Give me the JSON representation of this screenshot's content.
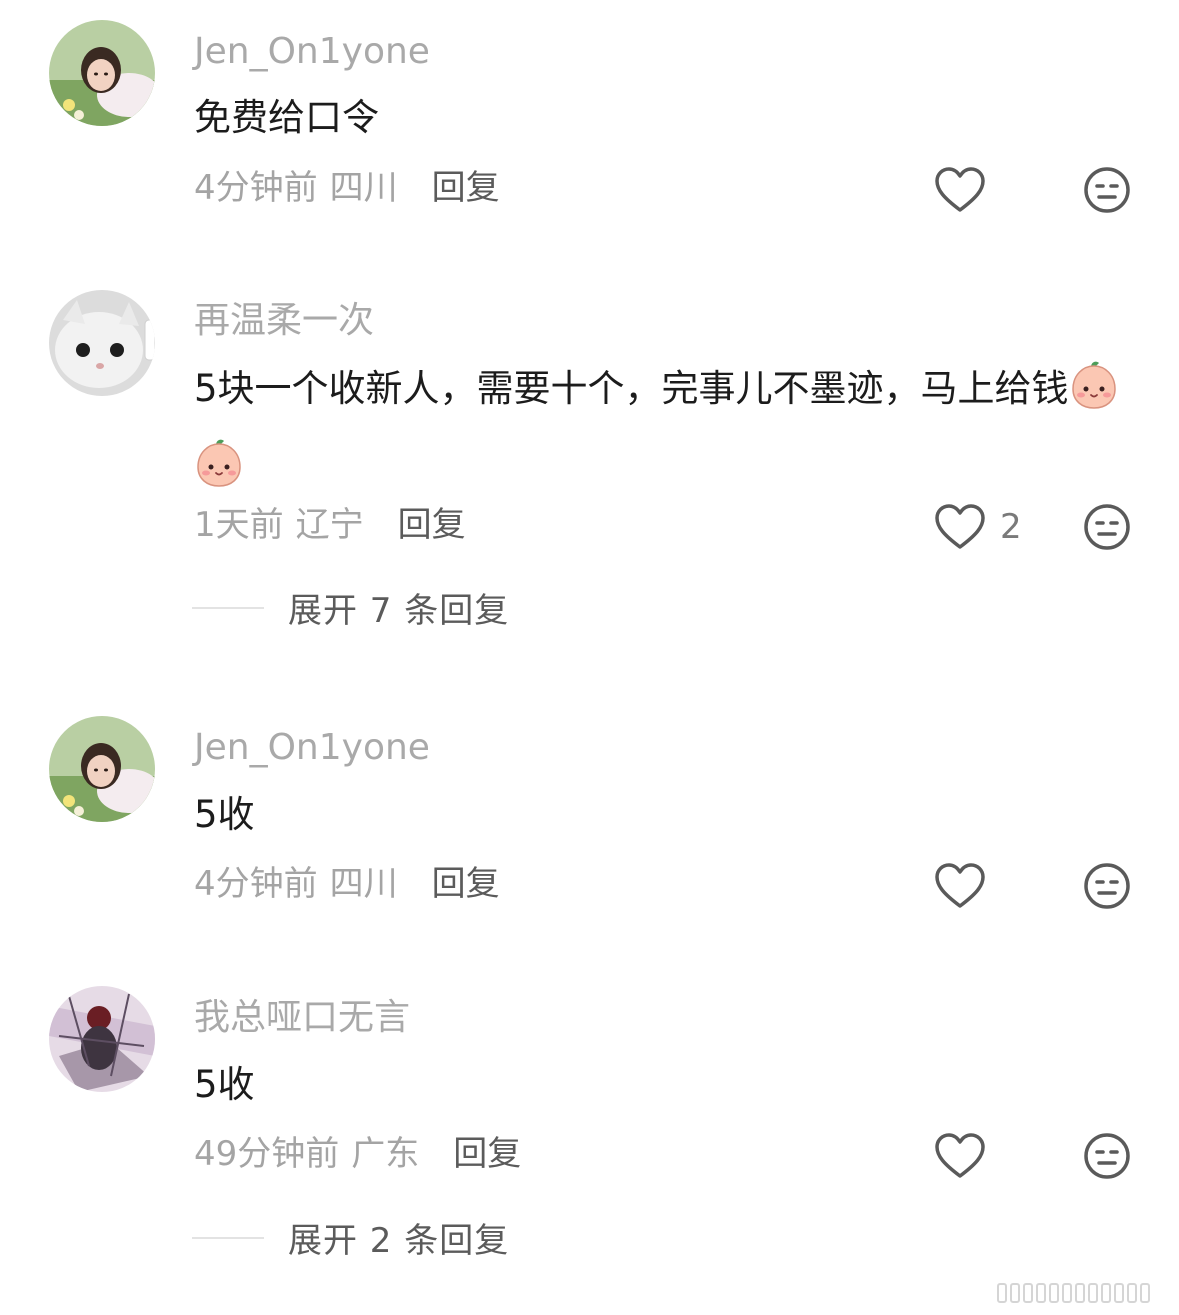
{
  "comments": [
    {
      "username": "Jen_On1yone",
      "text": "免费给口令",
      "time": "4分钟前",
      "region": "四川",
      "reply_label": "回复",
      "likes": "",
      "avatar": "girl-portrait-avatar"
    },
    {
      "username": "再温柔一次",
      "text": "5块一个收新人，需要十个，完事儿不墨迹，马上给钱",
      "emoji": [
        "peach-face-emoji",
        "peach-face-emoji"
      ],
      "time": "1天前",
      "region": "辽宁",
      "reply_label": "回复",
      "likes": "2",
      "expand_label": "展开 7 条回复",
      "avatar": "white-cat-avatar"
    },
    {
      "username": "Jen_On1yone",
      "text": "5收",
      "time": "4分钟前",
      "region": "四川",
      "reply_label": "回复",
      "likes": "",
      "avatar": "girl-portrait-avatar"
    },
    {
      "username": "我总哑口无言",
      "text": "5收",
      "time": "49分钟前",
      "region": "广东",
      "reply_label": "回复",
      "likes": "",
      "expand_label": "展开 2 条回复",
      "avatar": "dark-abstract-avatar"
    }
  ],
  "icons": {
    "like": "heart-outline-icon",
    "dislike": "neutral-face-icon"
  },
  "colors": {
    "username": "#a9a9a9",
    "body_text": "#1c1c1c",
    "meta": "#a4a4a4",
    "reply": "#5b5b5b",
    "icon_stroke": "#5a5a5a"
  }
}
